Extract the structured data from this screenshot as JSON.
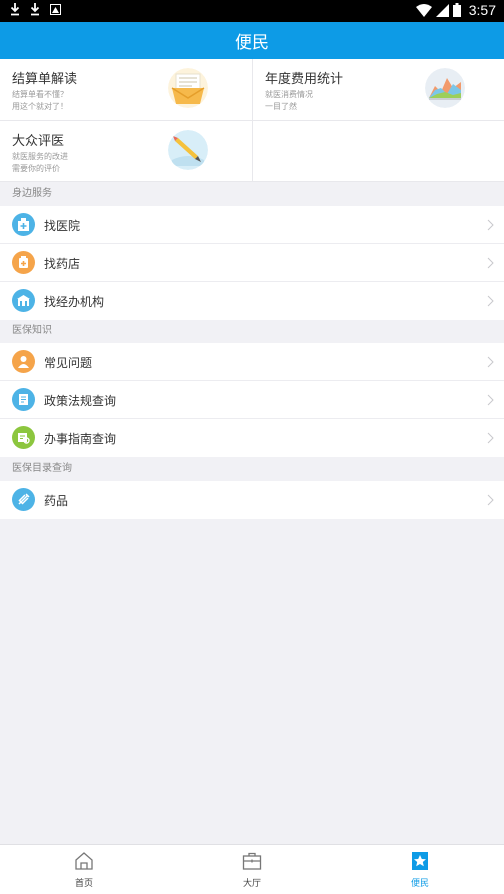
{
  "status_bar": {
    "time": "3:57"
  },
  "header": {
    "title": "便民"
  },
  "cards": [
    {
      "title": "结算单解读",
      "sub1": "结算单看不懂？",
      "sub2": "用这个就对了！",
      "icon": "document-envelope-icon"
    },
    {
      "title": "年度费用统计",
      "sub1": "就医消费情况",
      "sub2": "一目了然",
      "icon": "area-chart-icon"
    },
    {
      "title": "大众评医",
      "sub1": "就医服务的改进",
      "sub2": "需要你的评价",
      "icon": "pencil-icon"
    }
  ],
  "sections": [
    {
      "title": "身边服务",
      "items": [
        {
          "label": "找医院",
          "icon": "hospital-icon",
          "color": "#4db3e6"
        },
        {
          "label": "找药店",
          "icon": "pharmacy-icon",
          "color": "#f5a44a"
        },
        {
          "label": "找经办机构",
          "icon": "building-icon",
          "color": "#4db3e6"
        }
      ]
    },
    {
      "title": "医保知识",
      "items": [
        {
          "label": "常见问题",
          "icon": "question-icon",
          "color": "#f5a44a"
        },
        {
          "label": "政策法规查询",
          "icon": "policy-book-icon",
          "color": "#4db3e6"
        },
        {
          "label": "办事指南查询",
          "icon": "guide-icon",
          "color": "#8cc63e"
        }
      ]
    },
    {
      "title": "医保目录查询",
      "items": [
        {
          "label": "药品",
          "icon": "syringe-icon",
          "color": "#4db3e6"
        }
      ]
    }
  ],
  "tabs": [
    {
      "label": "首页",
      "icon": "home-icon",
      "active": false
    },
    {
      "label": "大厅",
      "icon": "briefcase-icon",
      "active": false
    },
    {
      "label": "便民",
      "icon": "star-bookmark-icon",
      "active": true
    }
  ],
  "colors": {
    "primary": "#0d9be6",
    "orange": "#f5a44a",
    "green": "#8cc63e"
  }
}
